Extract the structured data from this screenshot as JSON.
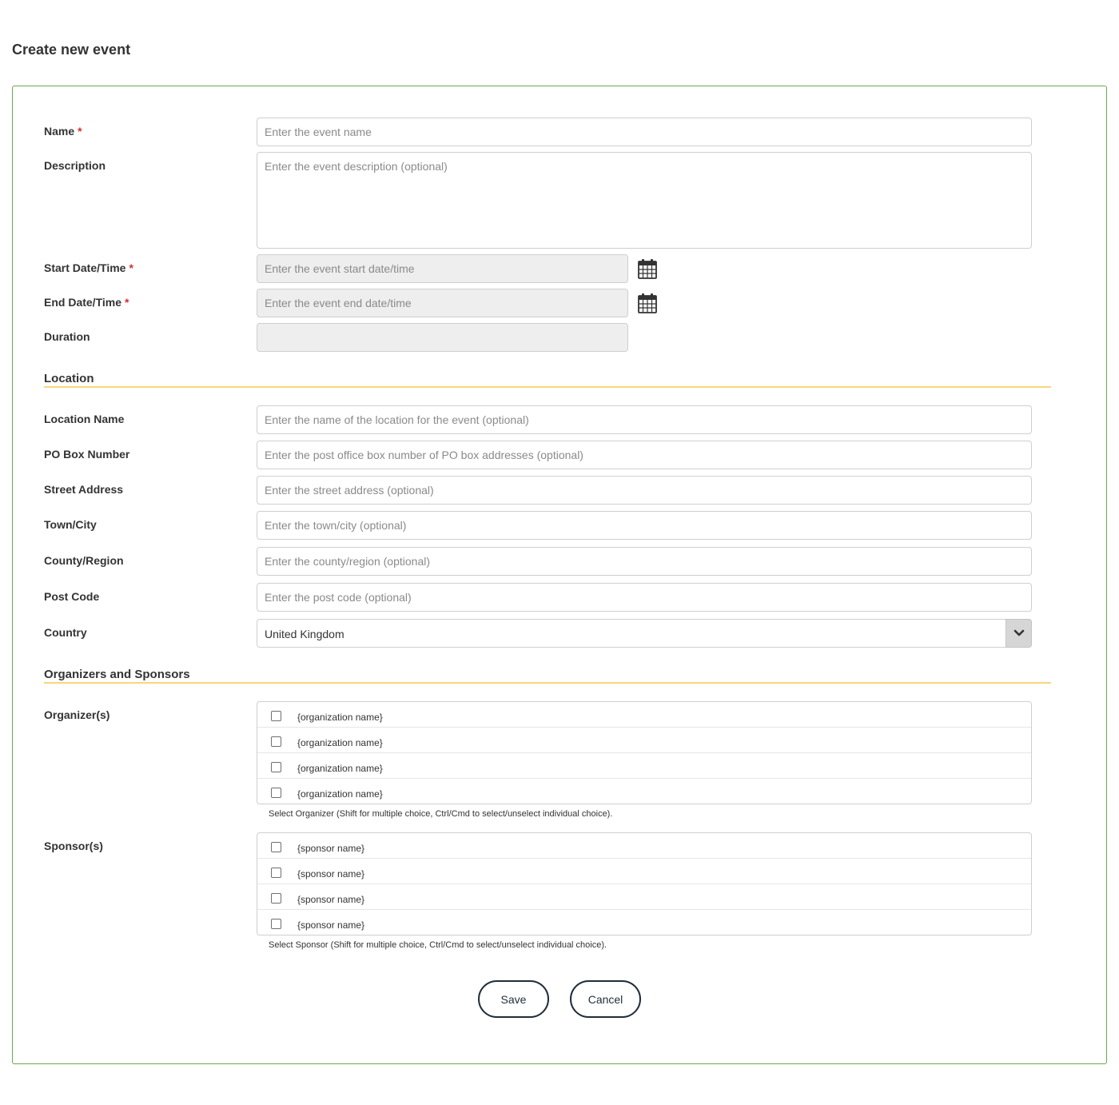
{
  "page": {
    "title": "Create new event"
  },
  "fields": {
    "name": {
      "label": "Name",
      "required_mark": "*",
      "placeholder": "Enter the event name"
    },
    "description": {
      "label": "Description",
      "placeholder": "Enter the event description (optional)"
    },
    "start": {
      "label": "Start Date/Time",
      "required_mark": "*",
      "placeholder": "Enter the event start date/time"
    },
    "end": {
      "label": "End Date/Time",
      "required_mark": "*",
      "placeholder": "Enter the event end date/time"
    },
    "duration": {
      "label": "Duration",
      "value": ""
    }
  },
  "location": {
    "heading": "Location",
    "location_name": {
      "label": "Location Name",
      "placeholder": "Enter the name of the location for the event (optional)"
    },
    "po_box": {
      "label": "PO Box Number",
      "placeholder": "Enter the post office box number of PO box addresses (optional)"
    },
    "street": {
      "label": "Street Address",
      "placeholder": "Enter the street address (optional)"
    },
    "town": {
      "label": "Town/City",
      "placeholder": "Enter the town/city (optional)"
    },
    "county": {
      "label": "County/Region",
      "placeholder": "Enter the county/region (optional)"
    },
    "post_code": {
      "label": "Post Code",
      "placeholder": "Enter the post code (optional)"
    },
    "country": {
      "label": "Country",
      "selected": "United Kingdom"
    }
  },
  "organizers_sponsors": {
    "heading": "Organizers and Sponsors",
    "organizers": {
      "label": "Organizer(s)",
      "items": [
        "{organization name}",
        "{organization name}",
        "{organization name}",
        "{organization name}"
      ],
      "help": "Select Organizer (Shift for multiple choice, Ctrl/Cmd to select/unselect individual choice)."
    },
    "sponsors": {
      "label": "Sponsor(s)",
      "items": [
        "{sponsor name}",
        "{sponsor name}",
        "{sponsor name}",
        "{sponsor name}"
      ],
      "help": "Select Sponsor (Shift for multiple choice, Ctrl/Cmd to select/unselect individual choice)."
    }
  },
  "actions": {
    "save_label": "Save",
    "cancel_label": "Cancel"
  },
  "icons": {
    "calendar": "calendar-icon",
    "dropdown": "chevron-down-icon"
  },
  "colors": {
    "panel_border": "#6aa84f",
    "section_rule": "#f6d77a",
    "required": "#d32f2f",
    "button_border": "#1f2d3a"
  }
}
